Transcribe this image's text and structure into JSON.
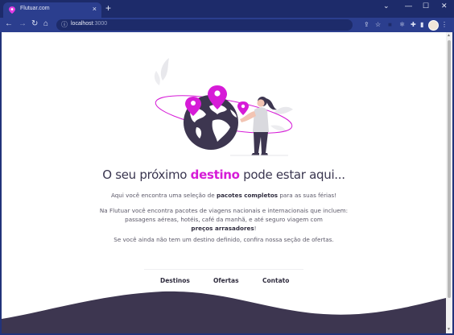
{
  "browser": {
    "tab_title": "Flutuar.com",
    "tab_close": "×",
    "new_tab": "+",
    "url_host": "localhost",
    "url_port": ":3000",
    "window_controls": [
      "—",
      "☐",
      "✕"
    ],
    "chevron": "⌄",
    "colors": {
      "frame": "#22337a",
      "toolbar": "#2b3e8e"
    }
  },
  "page": {
    "headline_pre": "O seu próximo ",
    "headline_accent": "destino",
    "headline_post": " pode estar aqui...",
    "p1_pre": "Aqui você encontra uma seleção de ",
    "p1_bold": "pacotes completos",
    "p1_post": " para as suas férias!",
    "p2_text": "Na Flutuar você encontra pacotes de viagens nacionais e internacionais que incluem: passagens aéreas, hotéis, café da manhã, e até seguro viagem com",
    "p2_bold": "preços arrasadores",
    "p2_post": "!",
    "p3": "Se você ainda não tem um destino definido, confira nossa seção de ofertas.",
    "nav": [
      "Destinos",
      "Ofertas",
      "Contato"
    ],
    "colors": {
      "accent": "#d61bd7",
      "dark": "#3d3650",
      "text": "#5b5868"
    }
  }
}
